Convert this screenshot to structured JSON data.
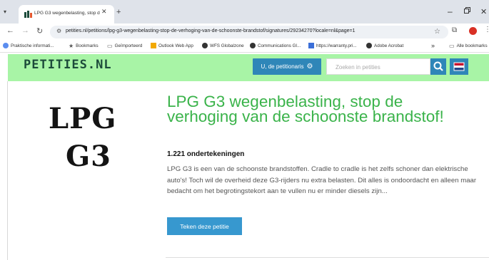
{
  "browser": {
    "tab": {
      "title": "LPG G3 wegenbelasting, stop de..."
    },
    "url": "petities.nl/petitions/lpg-g3-wegenbelasting-stop-de-verhoging-van-de-schoonste-brandstof/signatures/29234270?locale=nl&page=1",
    "bookmarks": [
      {
        "label": "Praktische informati...",
        "icon": "globe-icon"
      },
      {
        "label": "Bookmarks",
        "icon": "star-icon"
      },
      {
        "label": "Geïmporteerd",
        "icon": "folder-icon"
      },
      {
        "label": "Outlook Web App",
        "icon": "outlook-icon"
      },
      {
        "label": "WFS Globalzone",
        "icon": "globe-icon"
      },
      {
        "label": "Communications Gl...",
        "icon": "globe-icon"
      },
      {
        "label": "https://warranty.pri...",
        "icon": "page-icon"
      },
      {
        "label": "Adobe Acrobat",
        "icon": "globe-icon"
      },
      {
        "label": "Alle bookmarks",
        "icon": "folder-icon"
      }
    ],
    "overflow": "»"
  },
  "site": {
    "logo": "PETITIES.NL",
    "petitioner_button": "U, de petitionaris",
    "search_placeholder": "Zoeken in petities"
  },
  "petition": {
    "image_line1": "LPG",
    "image_line2": "G3",
    "title": "LPG G3 wegenbelasting, stop de verhoging van de schoonste brandstof!",
    "count": "1.221 ondertekeningen",
    "description": "LPG G3 is een van de schoonste brandstoffen. Cradle to cradle is het zelfs schoner dan elektrische auto's! Toch wil de overheid deze G3-rijders nu extra belasten. Dit alles is ondoordacht en alleen maar bedacht om het begrotingstekort aan te vullen nu er minder diesels zijn...",
    "sign_button": "Teken deze petitie"
  },
  "colors": {
    "header_bg": "#a8f4a6",
    "title_green": "#3ab34a",
    "button_blue": "#3798cf"
  }
}
